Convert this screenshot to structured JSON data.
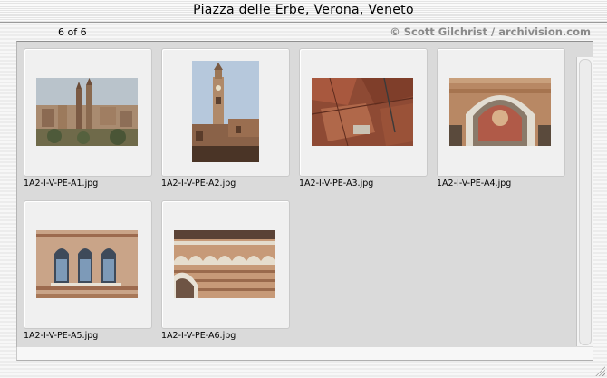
{
  "window": {
    "title": "Piazza delle Erbe, Verona, Veneto"
  },
  "header": {
    "counter": "6 of 6",
    "credit": "© Scott Gilchrist / archivision.com"
  },
  "thumbnails": [
    {
      "filename": "1A2-I-V-PE-A1.jpg",
      "icon": "city-skyline-photo"
    },
    {
      "filename": "1A2-I-V-PE-A2.jpg",
      "icon": "clock-tower-photo"
    },
    {
      "filename": "1A2-I-V-PE-A3.jpg",
      "icon": "rooftops-aerial-photo"
    },
    {
      "filename": "1A2-I-V-PE-A4.jpg",
      "icon": "arched-fresco-photo"
    },
    {
      "filename": "1A2-I-V-PE-A5.jpg",
      "icon": "triple-window-photo"
    },
    {
      "filename": "1A2-I-V-PE-A6.jpg",
      "icon": "arched-facade-photo"
    }
  ]
}
